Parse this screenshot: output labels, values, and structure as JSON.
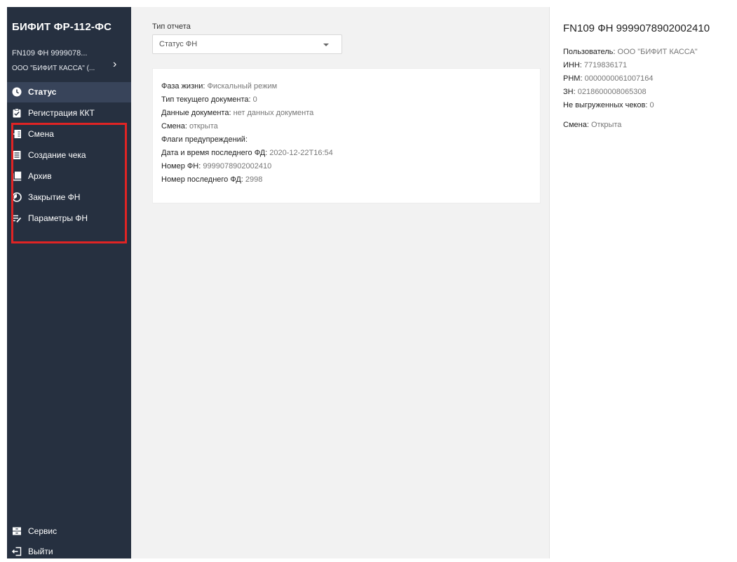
{
  "sidebar": {
    "brand": "БИФИТ ФР-112-ФС",
    "device_line1": "FN109 ФН 9999078...",
    "device_line2": "ООО \"БИФИТ КАССА\" (...",
    "items": [
      {
        "label": "Статус",
        "icon": "clock-icon"
      },
      {
        "label": "Регистрация ККТ",
        "icon": "clipboard-check-icon"
      },
      {
        "label": "Смена",
        "icon": "shift-icon"
      },
      {
        "label": "Создание чека",
        "icon": "receipt-icon"
      },
      {
        "label": "Архив",
        "icon": "archive-icon"
      },
      {
        "label": "Закрытие ФН",
        "icon": "pie-icon"
      },
      {
        "label": "Параметры ФН",
        "icon": "list-edit-icon"
      }
    ],
    "bottom_items": [
      {
        "label": "Сервис",
        "icon": "service-icon"
      },
      {
        "label": "Выйти",
        "icon": "logout-icon"
      }
    ]
  },
  "main": {
    "report_type_label": "Тип отчета",
    "report_type_value": "Статус ФН",
    "status": [
      {
        "key": "Фаза жизни",
        "value": "Фискальный режим"
      },
      {
        "key": "Тип текущего документа",
        "value": "0"
      },
      {
        "key": "Данные документа",
        "value": "нет данных документа"
      },
      {
        "key": "Смена",
        "value": "открыта"
      },
      {
        "key": "Флаги предупреждений",
        "value": ""
      },
      {
        "key": "Дата и время последнего ФД",
        "value": "2020-12-22T16:54"
      },
      {
        "key": "Номер ФН",
        "value": "9999078902002410"
      },
      {
        "key": "Номер последнего ФД",
        "value": "2998"
      }
    ]
  },
  "details": {
    "title": "FN109 ФН 9999078902002410",
    "rows": [
      {
        "key": "Пользователь",
        "value": "ООО \"БИФИТ КАССА\""
      },
      {
        "key": "ИНН",
        "value": "7719836171"
      },
      {
        "key": "РНМ",
        "value": "0000000061007164"
      },
      {
        "key": "ЗН",
        "value": "0218600008065308"
      },
      {
        "key": "Не выгруженных чеков",
        "value": "0"
      },
      {
        "key": "Смена",
        "value": "Открыта"
      }
    ]
  },
  "colors": {
    "sidebar_bg": "#263040",
    "sidebar_active": "#38445a",
    "highlight": "#e02424"
  }
}
